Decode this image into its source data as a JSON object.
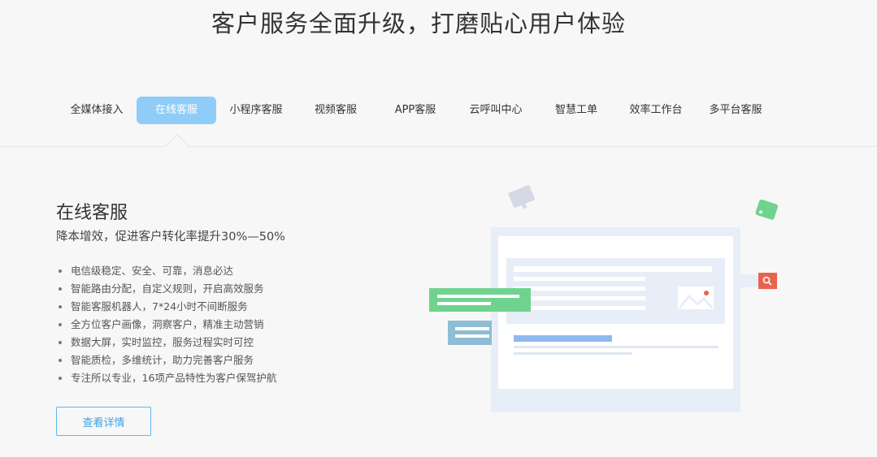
{
  "hero": {
    "title": "客户服务全面升级，打磨贴心用户体验"
  },
  "tabs": [
    {
      "label": "全媒体接入",
      "active": false
    },
    {
      "label": "在线客服",
      "active": true
    },
    {
      "label": "小程序客服",
      "active": false
    },
    {
      "label": "视频客服",
      "active": false
    },
    {
      "label": "APP客服",
      "active": false
    },
    {
      "label": "云呼叫中心",
      "active": false
    },
    {
      "label": "智慧工单",
      "active": false
    },
    {
      "label": "效率工作台",
      "active": false
    },
    {
      "label": "多平台客服",
      "active": false
    }
  ],
  "panel": {
    "title": "在线客服",
    "subtitle": "降本增效，促进客户转化率提升30%—50%",
    "features": [
      "电信级稳定、安全、可靠，消息必达",
      "智能路由分配，自定义规则，开启高效服务",
      "智能客服机器人，7*24小时不间断服务",
      "全方位客户画像，洞察客户，精准主动营销",
      "数据大屏，实时监控，服务过程实时可控",
      "智能质检，多维统计，助力完善客户服务",
      "专注所以专业，16项产品特性为客户保驾护航"
    ],
    "button_label": "查看详情"
  },
  "colors": {
    "active_tab": "#8fcdf8",
    "button_border": "#5fb8ec",
    "illustration_green": "#6fd38e",
    "illustration_blue": "#8ebdd5",
    "illustration_red": "#e8634e"
  },
  "icons": {
    "search": "search-icon",
    "image": "image-icon"
  }
}
